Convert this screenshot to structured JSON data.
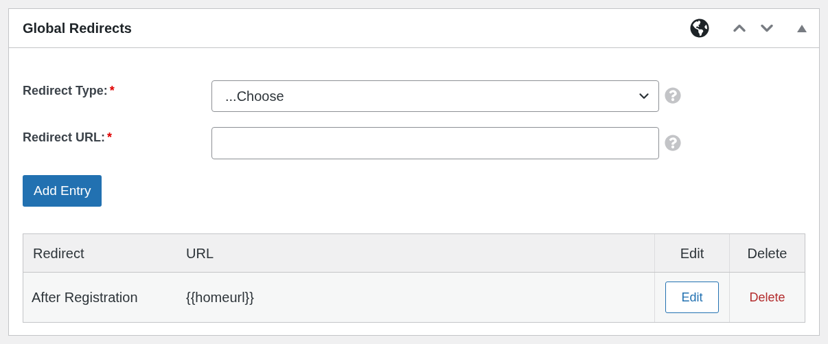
{
  "panel": {
    "title": "Global Redirects"
  },
  "fields": [
    {
      "kind": "select",
      "label": "Redirect Type:",
      "required_mark": "*",
      "value": "...Choose"
    },
    {
      "kind": "text",
      "label": "Redirect URL:",
      "required_mark": "*"
    }
  ],
  "add_button": "Add Entry",
  "table": {
    "columns": [
      "Redirect",
      "URL",
      "Edit",
      "Delete"
    ],
    "rows": [
      {
        "redirect": "After Registration",
        "url": "{{homeurl}}",
        "edit": "Edit",
        "delete": "Delete"
      }
    ]
  }
}
